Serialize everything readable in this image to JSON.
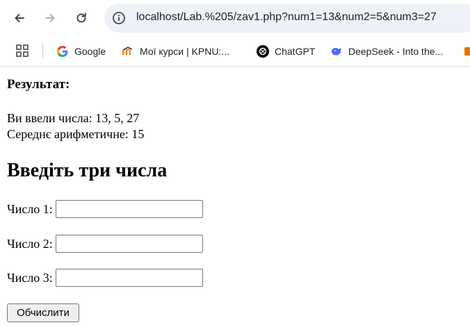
{
  "browser": {
    "url": "localhost/Lab.%205/zav1.php?num1=13&num2=5&num3=27",
    "bookmarks": [
      {
        "label": "Google",
        "icon": "google-icon"
      },
      {
        "label": "Мої курси | KPNU:...",
        "icon": "moodle-icon"
      },
      {
        "label": "ChatGPT",
        "icon": "chatgpt-icon"
      },
      {
        "label": "DeepSeek - Into the...",
        "icon": "deepseek-icon"
      }
    ]
  },
  "result": {
    "title": "Результат:",
    "entered_line": "Ви ввели числа: 13, 5, 27",
    "average_line": "Середнє арифметичне: 15"
  },
  "form": {
    "title": "Введіть три числа",
    "fields": [
      {
        "label": "Число 1:",
        "value": ""
      },
      {
        "label": "Число 2:",
        "value": ""
      },
      {
        "label": "Число 3:",
        "value": ""
      }
    ],
    "submit_label": "Обчислити"
  },
  "colors": {
    "omnibox_bg": "#eef1f8",
    "chrome_icon": "#5f6368"
  }
}
